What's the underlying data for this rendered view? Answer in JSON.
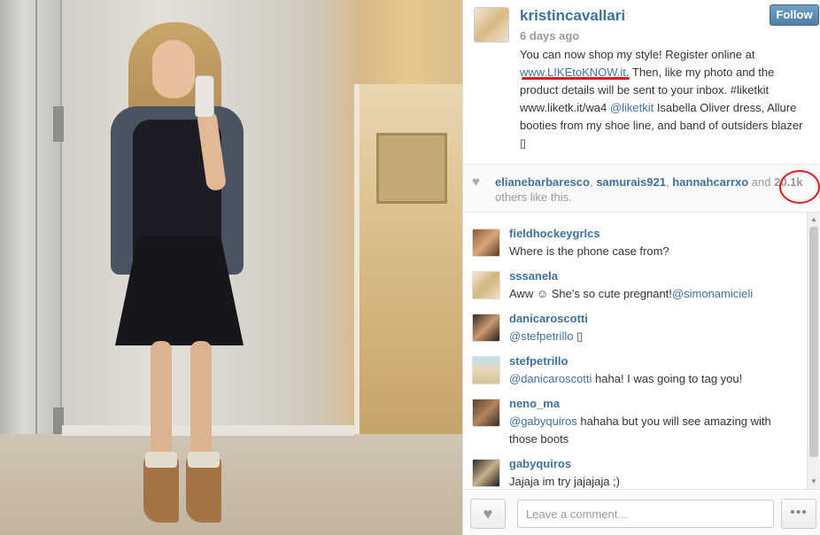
{
  "post": {
    "username": "kristincavallari",
    "time_ago": "6 days ago",
    "follow_label": "Follow",
    "caption": {
      "part1": "You can now shop my style! Register online at ",
      "link1": "www.LIKEtoKNOW.it",
      "part2": ". Then, like my photo and the product details will be sent to your inbox. #liketkit www.liketk.it/wa4 ",
      "link2": "@liketkit",
      "part3": " Isabella Oliver dress, Allure booties from my shoe line, and band of outsiders blazer ",
      "emoji": "▯"
    }
  },
  "likes": {
    "user1": "elianebarbaresco",
    "user2": "samurais921",
    "user3": "hannahcarrxo",
    "and_text": " and ",
    "count": "20.1k",
    "suffix": "others like this."
  },
  "comments": [
    {
      "user": "fieldhockeygrlcs",
      "pre": "Where is the phone case from?",
      "mention": "",
      "post": ""
    },
    {
      "user": "sssanela",
      "pre": "Aww ☺ She's so cute pregnant!",
      "mention": "@simonamicieli",
      "post": ""
    },
    {
      "user": "danicaroscotti",
      "pre": "",
      "mention": "@stefpetrillo",
      "post": " ▯"
    },
    {
      "user": "stefpetrillo",
      "pre": "",
      "mention": "@danicaroscotti",
      "post": " haha! I was going to tag you!"
    },
    {
      "user": "neno_ma",
      "pre": "",
      "mention": "@gabyquiros",
      "post": " hahaha but you will see amazing with those boots"
    },
    {
      "user": "gabyquiros",
      "pre": "Jajaja im try jajajaja ;)",
      "mention": "",
      "post": ""
    }
  ],
  "footer": {
    "comment_placeholder": "Leave a comment...",
    "heart_icon": "♥",
    "more_icon": "•••"
  },
  "colors": {
    "link": "#3f729b",
    "annotation": "#e01b1b",
    "follow": "#517fa4"
  }
}
